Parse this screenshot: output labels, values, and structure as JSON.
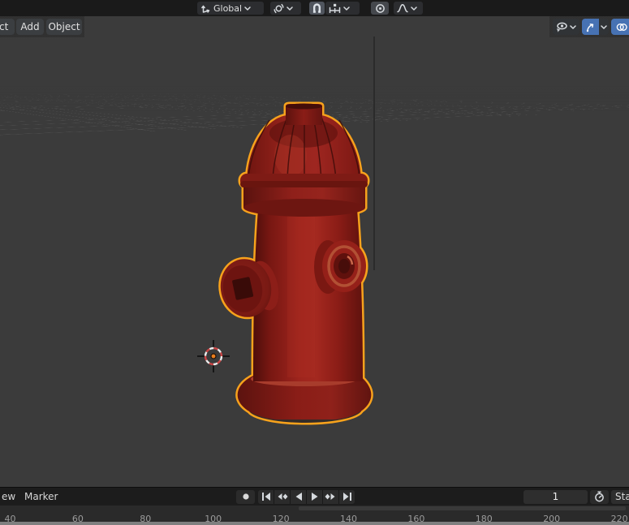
{
  "app": "blender-3d-viewport",
  "colors": {
    "accent_blue": "#4772b3",
    "selection_outline": "#f7a21c",
    "axis_x": "#c8807f",
    "axis_y": "#a2bf5f",
    "grid_line": "rgba(230,230,230,0.15)",
    "viewport_bg": "#3b3b3b",
    "statusbar_strip": "#7f7f7f"
  },
  "topbar": {
    "orientation": {
      "icon": "orientation-axes-icon",
      "label": "Global"
    },
    "pivot": {
      "icon": "pivot-point-icon"
    },
    "snap": {
      "magnet_icon": "magnet-icon",
      "mode_icon": "snap-increment-icon"
    },
    "proportional": {
      "icon": "proportional-editing-icon"
    },
    "falloff": {
      "icon": "falloff-curve-icon"
    }
  },
  "viewport_header": {
    "menus": [
      {
        "label": "ect"
      },
      {
        "label": "Add"
      },
      {
        "label": "Object"
      }
    ],
    "right_buttons": [
      {
        "icon": "show-gizmo-eye-icon",
        "active": false
      },
      {
        "icon": "gizmo-arrow-icon",
        "active": true
      },
      {
        "icon": "overlays-icon",
        "active": true
      }
    ]
  },
  "scene": {
    "object": "fire-hydrant",
    "selected": true
  },
  "timeline": {
    "menus": [
      {
        "label": "ew"
      },
      {
        "label": "Marker"
      }
    ],
    "transport": [
      "record",
      "jump-to-start",
      "previous-keyframe",
      "play-reverse",
      "play-forward",
      "next-keyframe",
      "jump-to-end"
    ],
    "frame_field": "1",
    "stopwatch_icon": "stopwatch-icon",
    "start_label": "Sta",
    "ruler_labels": [
      "40",
      "60",
      "80",
      "100",
      "120",
      "140",
      "160",
      "180",
      "200",
      "220"
    ]
  }
}
